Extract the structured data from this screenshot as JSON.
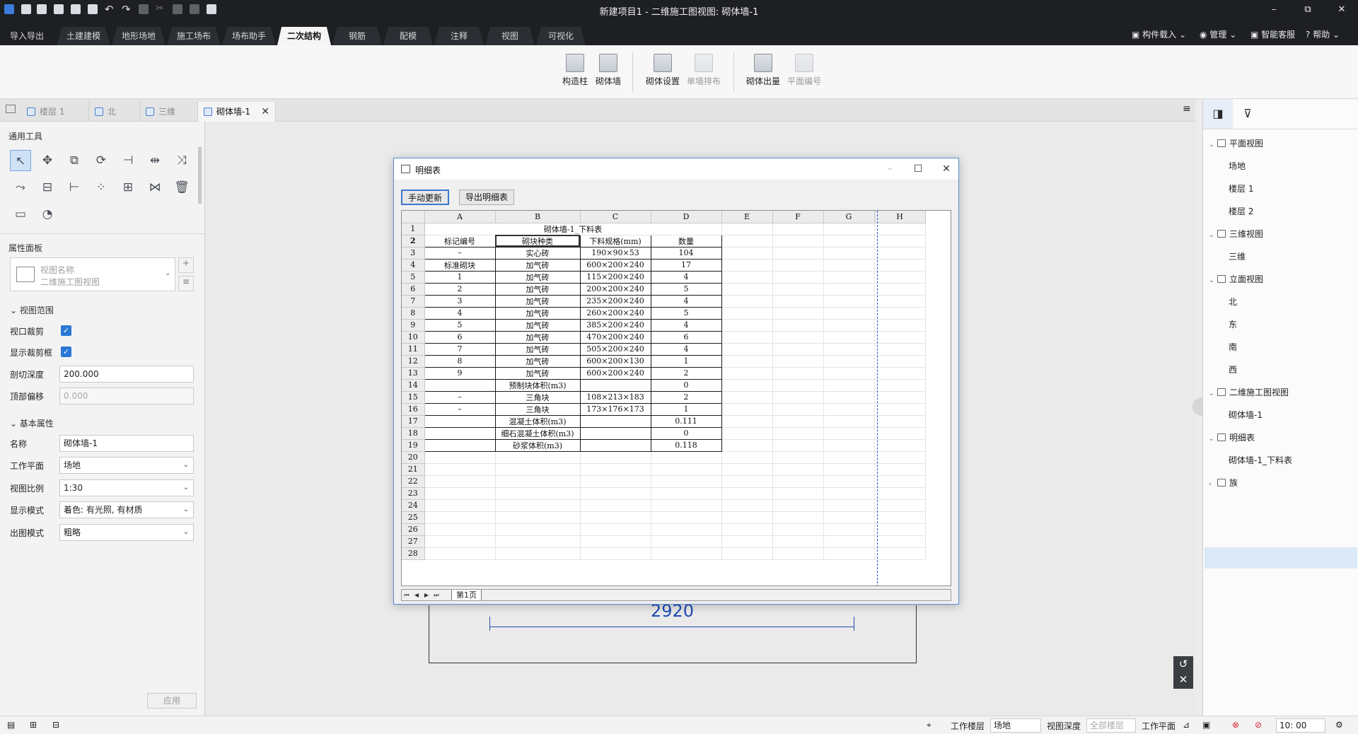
{
  "titlebar": {
    "title": "新建项目1 - 二维施工图视图: 砌体墙-1",
    "min": "–",
    "max": "⧉",
    "close": "✕"
  },
  "ribbon_tabs": [
    "导入导出",
    "土建建模",
    "地形场地",
    "施工场布",
    "场布助手",
    "二次结构",
    "钢筋",
    "配模",
    "注释",
    "视图",
    "可视化"
  ],
  "ribbon_active": "二次结构",
  "ribbon_right": {
    "component_load": "构件载入",
    "manage": "管理",
    "service": "智能客服",
    "help": "帮助"
  },
  "ribbon_buttons": [
    {
      "label": "构造柱",
      "enabled": true
    },
    {
      "label": "砌体墙",
      "enabled": true
    },
    {
      "label": "砌体设置",
      "enabled": true
    },
    {
      "label": "单墙排布",
      "enabled": false
    },
    {
      "label": "砌体出量",
      "enabled": true
    },
    {
      "label": "平面编号",
      "enabled": false
    }
  ],
  "doc_tabs": [
    "楼层 1",
    "北",
    "三维",
    "砌体墙-1"
  ],
  "left_panel": {
    "tools_title": "通用工具",
    "props_title": "属性面板",
    "view_name_label": "视图名称",
    "view_name_value": "二维施工图视图",
    "section_view_range": "视图范围",
    "section_basic": "基本属性",
    "props": {
      "viewport_clip_label": "视口裁剪",
      "show_clip_label": "显示裁剪框",
      "cut_depth_label": "剖切深度",
      "cut_depth": "200.000",
      "top_offset_label": "顶部偏移",
      "top_offset": "0.000",
      "name_label": "名称",
      "name": "砌体墙-1",
      "workplane_label": "工作平面",
      "workplane": "场地",
      "scale_label": "视图比例",
      "scale": "1:30",
      "display_label": "显示模式",
      "display": "着色: 有光照, 有材质",
      "output_label": "出图模式",
      "output": "粗略"
    },
    "apply": "应用"
  },
  "dialog": {
    "title": "明细表",
    "btn_update": "手动更新",
    "btn_export": "导出明细表",
    "col_letters": [
      "A",
      "B",
      "C",
      "D",
      "E",
      "F",
      "G",
      "H"
    ],
    "sheet_title": "砌体墙-1_下料表",
    "headers": [
      "标记编号",
      "砌块种类",
      "下料规格(mm)",
      "数量"
    ],
    "rows": [
      [
        "–",
        "实心砖",
        "190×90×53",
        "104"
      ],
      [
        "标准砌块",
        "加气砖",
        "600×200×240",
        "17"
      ],
      [
        "1",
        "加气砖",
        "115×200×240",
        "4"
      ],
      [
        "2",
        "加气砖",
        "200×200×240",
        "5"
      ],
      [
        "3",
        "加气砖",
        "235×200×240",
        "4"
      ],
      [
        "4",
        "加气砖",
        "260×200×240",
        "5"
      ],
      [
        "5",
        "加气砖",
        "385×200×240",
        "4"
      ],
      [
        "6",
        "加气砖",
        "470×200×240",
        "6"
      ],
      [
        "7",
        "加气砖",
        "505×200×240",
        "4"
      ],
      [
        "8",
        "加气砖",
        "600×200×130",
        "1"
      ],
      [
        "9",
        "加气砖",
        "600×200×240",
        "2"
      ],
      [
        "",
        "预制块体积(m3)",
        "",
        "0"
      ],
      [
        "–",
        "三角块",
        "108×213×183",
        "2"
      ],
      [
        "–",
        "三角块",
        "173×176×173",
        "1"
      ],
      [
        "",
        "混凝土体积(m3)",
        "",
        "0.111"
      ],
      [
        "",
        "细石混凝土体积(m3)",
        "",
        "0"
      ],
      [
        "",
        "砂浆体积(m3)",
        "",
        "0.118"
      ]
    ],
    "empty_row_count": 9,
    "sheet_tab": "第1页"
  },
  "drawing": {
    "dimension": "2920"
  },
  "right_panel": {
    "tree": [
      {
        "label": "平面视图",
        "level": 0,
        "expanded": true
      },
      {
        "label": "场地",
        "level": 1
      },
      {
        "label": "楼层 1",
        "level": 1
      },
      {
        "label": "楼层 2",
        "level": 1
      },
      {
        "label": "三维视图",
        "level": 0,
        "expanded": true
      },
      {
        "label": "三维",
        "level": 1
      },
      {
        "label": "立面视图",
        "level": 0,
        "expanded": true
      },
      {
        "label": "北",
        "level": 1
      },
      {
        "label": "东",
        "level": 1
      },
      {
        "label": "南",
        "level": 1
      },
      {
        "label": "西",
        "level": 1
      },
      {
        "label": "二维施工图视图",
        "level": 0,
        "expanded": true
      },
      {
        "label": "砌体墙-1",
        "level": 1
      },
      {
        "label": "明细表",
        "level": 0,
        "expanded": true
      },
      {
        "label": "砌体墙-1_下料表",
        "level": 1,
        "selected": true
      },
      {
        "label": "族",
        "level": 0,
        "expanded": false
      }
    ]
  },
  "status": {
    "work_floor_label": "工作楼层",
    "work_floor": "场地",
    "view_depth_label": "视图深度",
    "view_depth": "全部楼层",
    "work_plane_label": "工作平面",
    "time": "10: 00"
  }
}
